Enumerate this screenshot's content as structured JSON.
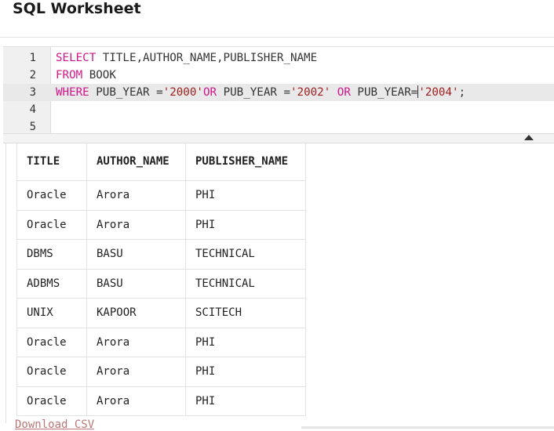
{
  "page": {
    "title": "SQL Worksheet"
  },
  "editor": {
    "line_numbers": [
      "1",
      "2",
      "3",
      "4",
      "5"
    ],
    "lines": [
      {
        "kw": "SELECT",
        "rest": " TITLE,AUTHOR_NAME,PUBLISHER_NAME"
      },
      {
        "kw": "FROM",
        "rest": " BOOK"
      },
      {
        "kw1": "WHERE",
        "t1": " PUB_YEAR =",
        "s1": "'2000'",
        "kw2": "OR",
        "t2": " PUB_YEAR =",
        "s2": "'2002'",
        "t3": " ",
        "kw3": "OR",
        "t4": " PUB_YEAR=",
        "s3": "'2004'",
        "t5": ";"
      }
    ]
  },
  "results": {
    "columns": [
      "TITLE",
      "AUTHOR_NAME",
      "PUBLISHER_NAME"
    ],
    "rows": [
      [
        "Oracle",
        "Arora",
        "PHI"
      ],
      [
        "Oracle",
        "Arora",
        "PHI"
      ],
      [
        "DBMS",
        "BASU",
        "TECHNICAL"
      ],
      [
        "ADBMS",
        "BASU",
        "TECHNICAL"
      ],
      [
        "UNIX",
        "KAPOOR",
        "SCITECH"
      ],
      [
        "Oracle",
        "Arora",
        "PHI"
      ],
      [
        "Oracle",
        "Arora",
        "PHI"
      ],
      [
        "Oracle",
        "Arora",
        "PHI"
      ]
    ]
  },
  "download_label": "Download CSV"
}
